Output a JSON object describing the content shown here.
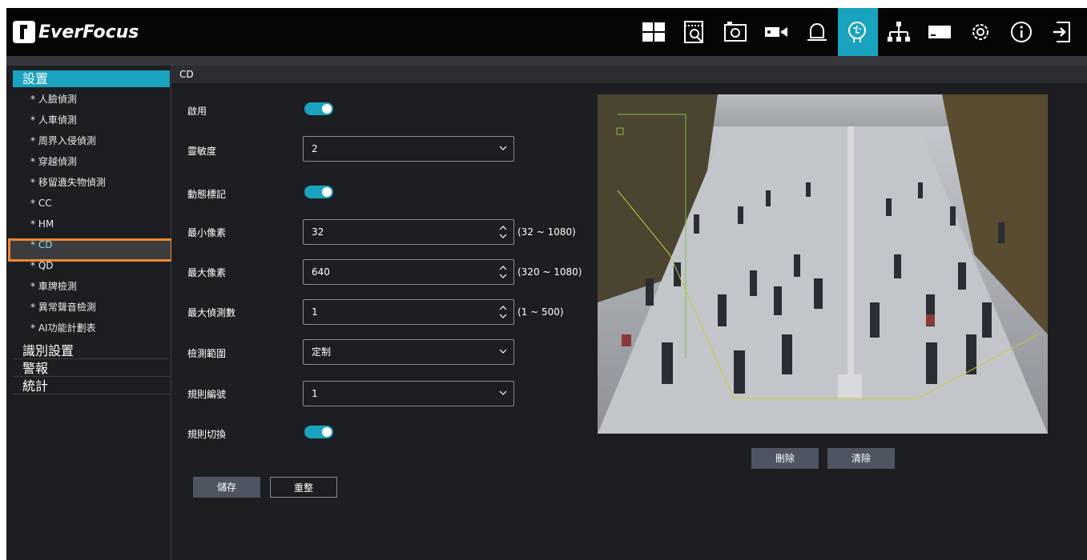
{
  "brand": {
    "name": "EverFocus"
  },
  "toolbar": {
    "icons": [
      "live-view-icon",
      "playback-icon",
      "snapshot-icon",
      "camera-icon",
      "alarm-icon",
      "ai-icon",
      "network-icon",
      "storage-icon",
      "settings-icon",
      "info-icon",
      "logout-icon"
    ],
    "active_icon": "ai-icon"
  },
  "sidebar": {
    "section_title": "設置",
    "items": [
      "* 人臉偵測",
      "* 人車偵測",
      "* 周界入侵偵測",
      "* 穿越偵測",
      "* 移留遺失物偵測",
      "* CC",
      "* HM",
      "* CD",
      "* QD",
      "* 車牌檢測",
      "* 異常聲音檢測",
      "* AI功能計劃表"
    ],
    "selected_item": "* CD",
    "groups": [
      "識別設置",
      "警報",
      "統計"
    ]
  },
  "page": {
    "title": "CD"
  },
  "form": {
    "enable_label": "啟用",
    "enable_on": true,
    "sensitivity_label": "靈敏度",
    "sensitivity_value": "2",
    "dynamic_mark_label": "動態標記",
    "dynamic_mark_on": true,
    "min_pixel_label": "最小像素",
    "min_pixel_value": "32",
    "min_pixel_range": "(32 ~ 1080)",
    "max_pixel_label": "最大像素",
    "max_pixel_value": "640",
    "max_pixel_range": "(320 ~ 1080)",
    "max_detect_label": "最大偵測數",
    "max_detect_value": "1",
    "max_detect_range": "(1 ~ 500)",
    "detect_area_label": "檢測範圍",
    "detect_area_value": "定制",
    "rule_number_label": "規則編號",
    "rule_number_value": "1",
    "rule_switch_label": "規則切換",
    "rule_switch_on": true
  },
  "buttons": {
    "save": "儲存",
    "reset": "重整",
    "delete": "刪除",
    "clear": "清除"
  },
  "colors": {
    "accent": "#1aa3bf",
    "background": "#1d1e22",
    "topbar": "#050505",
    "highlight": "#f0862e"
  }
}
